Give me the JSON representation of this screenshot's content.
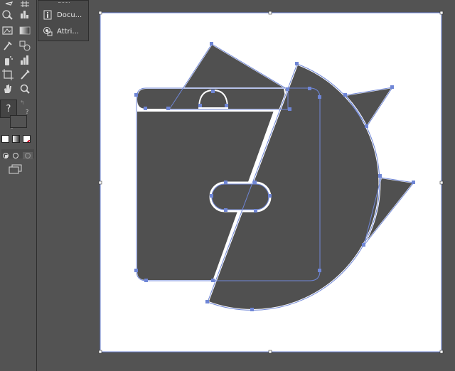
{
  "toolbar": {
    "tools": [
      {
        "name": "lasso-tool",
        "icon": "lasso-icon"
      },
      {
        "name": "mesh-tool",
        "icon": "mesh-icon"
      },
      {
        "name": "pathfinder-tool",
        "icon": "pathfinder-icon"
      },
      {
        "name": "chart-tool",
        "icon": "chart-icon"
      },
      {
        "name": "perspective-tool",
        "icon": "perspective-icon"
      },
      {
        "name": "gradient-tool",
        "icon": "gradient-icon"
      },
      {
        "name": "eyedropper-tool",
        "icon": "eyedropper-icon"
      },
      {
        "name": "blend-tool",
        "icon": "blend-icon"
      },
      {
        "name": "symbol-sprayer-tool",
        "icon": "symbol-sprayer-icon"
      },
      {
        "name": "column-graph-tool",
        "icon": "column-graph-icon"
      },
      {
        "name": "artboard-tool",
        "icon": "artboard-icon"
      },
      {
        "name": "slice-tool",
        "icon": "slice-icon"
      },
      {
        "name": "hand-tool",
        "icon": "hand-icon"
      },
      {
        "name": "zoom-tool",
        "icon": "zoom-icon"
      }
    ],
    "fill_stroke_label": "?",
    "fill_stroke_small_label": "?",
    "colors": {
      "none_swatch": "#ffffff",
      "gradient_swatch": "#888888",
      "none_slash": "#d8001e"
    }
  },
  "panel": {
    "items": [
      {
        "label": "Docu...",
        "icon": "document-info-icon"
      },
      {
        "label": "Attri...",
        "icon": "attributes-icon"
      }
    ]
  },
  "artwork": {
    "fill": "#505050",
    "outline": "#ffffff",
    "selection_color": "#6f86d6"
  }
}
